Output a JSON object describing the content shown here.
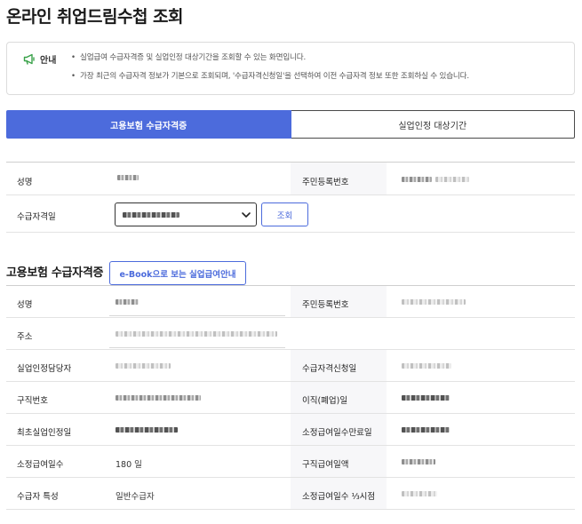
{
  "page": {
    "title": "온라인 취업드림수첩 조회"
  },
  "notice": {
    "label": "안내",
    "items": [
      "실업급여 수급자격증 및 실업인정 대상기간을 조회할 수 있는 화면입니다.",
      "가장 최근의 수급자격 정보가 기본으로 조회되며, '수급자격신청일'을 선택하여 이전 수급자격 정보 또한 조회하실 수 있습니다."
    ]
  },
  "tabs": [
    {
      "label": "고용보험 수급자격증",
      "active": true
    },
    {
      "label": "실업인정 대상기간",
      "active": false
    }
  ],
  "search": {
    "name_label": "성명",
    "rrn_label": "주민등록번호",
    "date_label": "수급자격일",
    "search_button": "조회"
  },
  "certificate": {
    "title": "고용보험 수급자격증",
    "ebook_button": "e-Book으로 보는 실업급여안내",
    "rows": [
      {
        "label": "성명",
        "value": null,
        "label2": "주민등록번호",
        "value2": null
      },
      {
        "label": "주소",
        "value": null,
        "label2": null,
        "value2": null
      },
      {
        "label": "실업인정담당자",
        "value": null,
        "label2": "수급자격신청일",
        "value2": null
      },
      {
        "label": "구직번호",
        "value": null,
        "label2": "이직(폐업)일",
        "value2": null
      },
      {
        "label": "최초실업인정일",
        "value": null,
        "label2": "소정급여일수만료일",
        "value2": null
      },
      {
        "label": "소정급여일수",
        "value": "180 일",
        "label2": "구직급여일액",
        "value2": null
      },
      {
        "label": "수급자 특성",
        "value": "일반수급자",
        "label2": "소정급여일수 ⅓시점",
        "value2": null
      }
    ]
  },
  "colors": {
    "accent": "#4c6bdc",
    "border": "#e3e3e3",
    "text": "#222222"
  },
  "icons": {
    "notice": "megaphone-icon",
    "select": "chevron-down-icon"
  }
}
